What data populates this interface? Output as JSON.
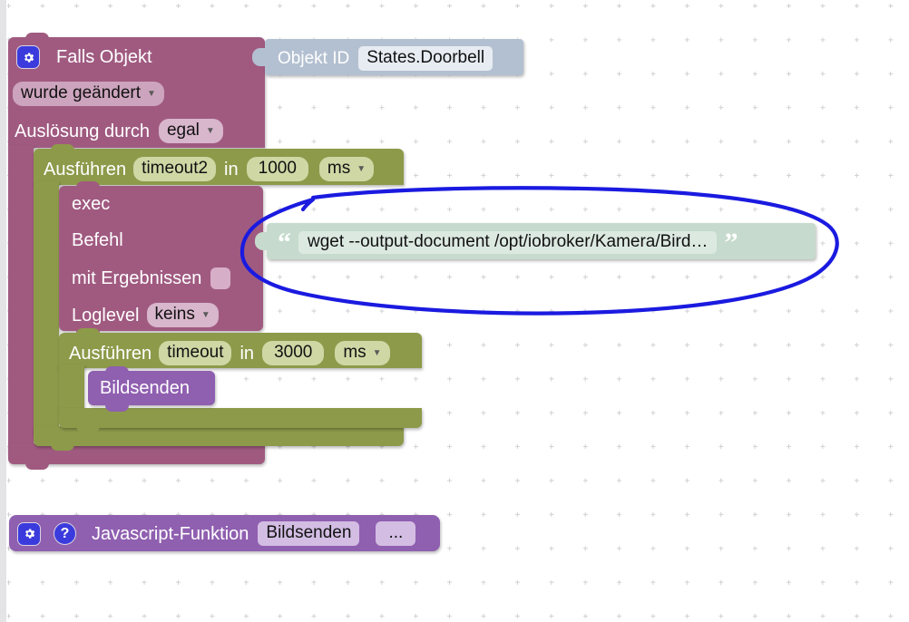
{
  "workspace": {
    "app": "ioBroker Blockly Editor",
    "background": "#ffffff",
    "grid_color": "#d2d2d6"
  },
  "colors": {
    "trigger_block": "#a05a80",
    "timeout_block": "#8d9a4a",
    "function_block": "#8f5fb0",
    "object_id_block": "#b3c0d1",
    "text_block": "#c6dbcd",
    "annotation": "#1a1ae0"
  },
  "blocks": {
    "trigger": {
      "gear_icon": "gear-icon",
      "title": "Falls Objekt",
      "object_id_label": "Objekt ID",
      "object_id_value": "States.Doorbell",
      "change_mode": "wurde geändert",
      "trigger_by_label": "Auslösung durch",
      "trigger_by_value": "egal"
    },
    "timeout_outer": {
      "label": "Ausführen",
      "name": "timeout2",
      "in_label": "in",
      "delay": "1000",
      "unit": "ms"
    },
    "exec": {
      "title": "exec",
      "command_label": "Befehl",
      "command_value": "wget --output-document /opt/iobroker/Kamera/Bird…",
      "with_results_label": "mit Ergebnissen",
      "with_results_checked": false,
      "loglevel_label": "Loglevel",
      "loglevel_value": "keins"
    },
    "timeout_inner": {
      "label": "Ausführen",
      "name": "timeout",
      "in_label": "in",
      "delay": "3000",
      "unit": "ms"
    },
    "call_function": {
      "label": "Bildsenden"
    },
    "javascript_function": {
      "gear_icon": "gear-icon",
      "help_icon": "help-icon",
      "label": "Javascript-Funktion",
      "name": "Bildsenden",
      "more": "..."
    }
  }
}
